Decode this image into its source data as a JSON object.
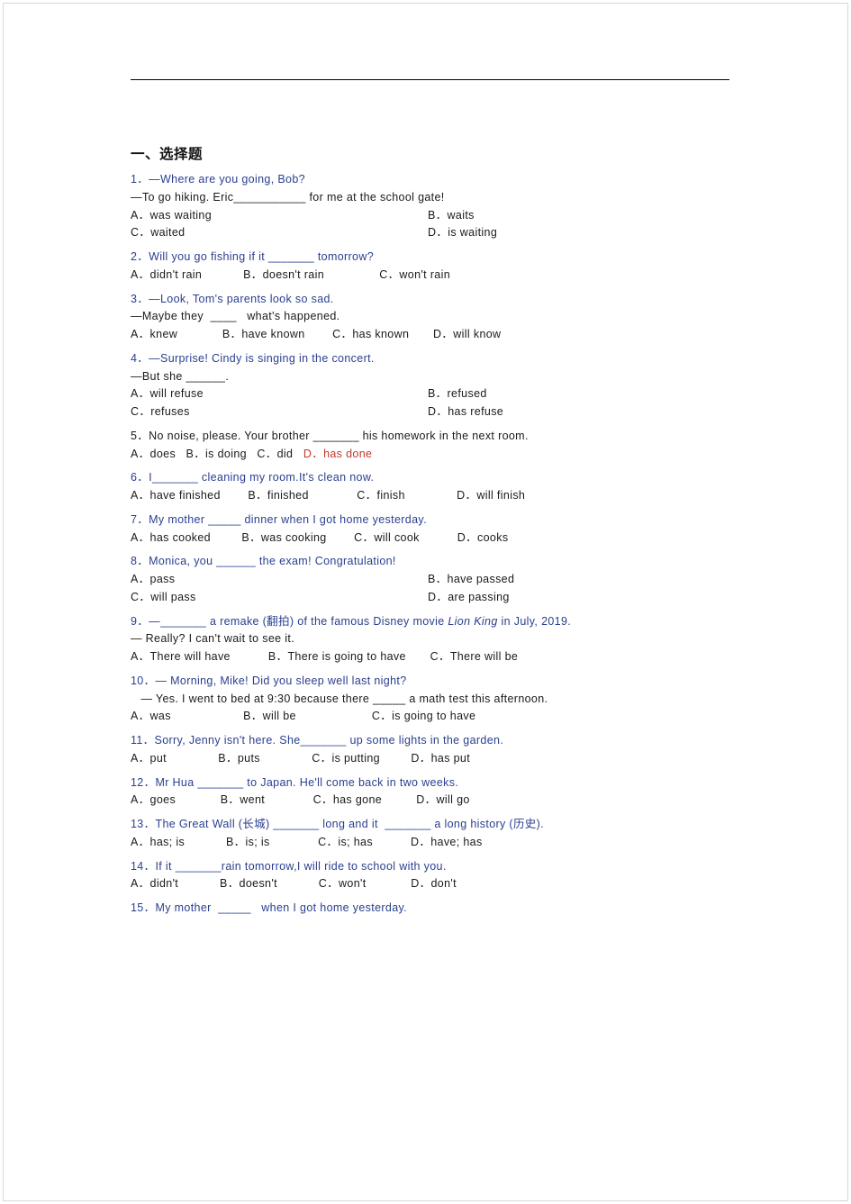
{
  "document": {
    "section_title": "一、选择题",
    "questions": [
      {
        "id": "q1",
        "lines": [
          "1．—Where are you going, Bob?",
          "—To go hiking. Eric___________ for me at the school gate!"
        ],
        "option_rows": [
          [
            "A．was waiting",
            "B．waits"
          ],
          [
            "C．waited",
            "D．is waiting"
          ]
        ]
      },
      {
        "id": "q2",
        "lines": [
          "2．Will you go fishing if it _______ tomorrow?"
        ],
        "option_line": "A．didn't rain            B．doesn't rain                C．won't rain"
      },
      {
        "id": "q3",
        "lines": [
          "3．—Look, Tom's parents look so sad.",
          "—Maybe they  ____   what's happened."
        ],
        "option_line": "A．knew             B．have known        C．has known       D．will know"
      },
      {
        "id": "q4",
        "lines": [
          "4．—Surprise! Cindy is singing in the concert.",
          "—But she ______."
        ],
        "option_rows": [
          [
            "A．will refuse",
            "B．refused"
          ],
          [
            "C．refuses",
            "D．has refuse"
          ]
        ]
      },
      {
        "id": "q5",
        "lines": [
          "5．No noise, please. Your brother _______ his homework in the next room."
        ],
        "option_line_pre": "A．does   B．is doing   C．did   ",
        "option_line_red": "D．has done"
      },
      {
        "id": "q6",
        "lines": [
          "6．I_______ cleaning my room.It's clean now."
        ],
        "option_line": "A．have finished        B．finished              C．finish               D．will finish"
      },
      {
        "id": "q7",
        "lines": [
          "7．My mother _____ dinner when I got home yesterday."
        ],
        "option_line": "A．has cooked         B．was cooking        C．will cook           D．cooks"
      },
      {
        "id": "q8",
        "lines": [
          "8．Monica, you ______ the exam! Congratulation!"
        ],
        "option_rows": [
          [
            "A．pass",
            "B．have passed"
          ],
          [
            "C．will pass",
            "D．are passing"
          ]
        ]
      },
      {
        "id": "q9",
        "lines_rich": [
          {
            "pre": "9．—_______ a remake (翻拍) of the famous Disney movie ",
            "ital": "Lion King",
            "post": " in July, 2019."
          },
          {
            "pre": "— Really? I can't wait to see it.",
            "ital": "",
            "post": ""
          }
        ],
        "option_line": "A．There will have           B．There is going to have       C．There will be"
      },
      {
        "id": "q10",
        "lines": [
          "10．— Morning, Mike! Did you sleep well last night?",
          "   — Yes. I went to bed at 9:30 because there _____ a math test this afternoon."
        ],
        "option_line": "A．was                     B．will be                      C．is going to have"
      },
      {
        "id": "q11",
        "lines": [
          "11．Sorry, Jenny isn't here. She_______ up some lights in the garden."
        ],
        "option_line": "A．put               B．puts               C．is putting         D．has put"
      },
      {
        "id": "q12",
        "lines": [
          "12．Mr Hua _______ to Japan. He'll come back in two weeks."
        ],
        "option_line": "A．goes             B．went              C．has gone          D．will go"
      },
      {
        "id": "q13",
        "lines": [
          "13．The Great Wall (长城) _______ long and it  _______ a long history (历史)."
        ],
        "option_line": "A．has; is            B．is; is              C．is; has           D．have; has"
      },
      {
        "id": "q14",
        "lines": [
          "14．If it _______rain tomorrow,I will ride to school with you."
        ],
        "option_line": "A．didn't            B．doesn't            C．won't             D．don't"
      },
      {
        "id": "q15",
        "lines": [
          "15．My mother  _____   when I got home yesterday."
        ],
        "option_line": ""
      }
    ]
  }
}
